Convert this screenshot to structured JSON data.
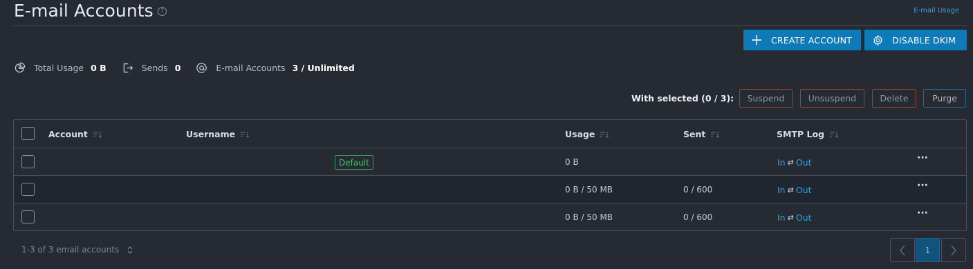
{
  "header": {
    "title": "E-mail Accounts",
    "help_icon": "question-circle-icon",
    "usage_link": "E-mail Usage"
  },
  "actions": {
    "create_label": "CREATE ACCOUNT",
    "create_icon": "plus-icon",
    "dkim_label": "DISABLE DKIM",
    "dkim_icon": "gear-icon",
    "accent_color": "#0f7ab8"
  },
  "stats": {
    "usage_label": "Total Usage",
    "usage_value": "0 B",
    "sends_label": "Sends",
    "sends_value": "0",
    "accounts_label": "E-mail Accounts",
    "accounts_value": "3 / Unlimited"
  },
  "bulk": {
    "label": "With selected (0 / 3):",
    "suspend": "Suspend",
    "unsuspend": "Unsuspend",
    "delete": "Delete",
    "purge": "Purge"
  },
  "table": {
    "columns": {
      "account": "Account",
      "username": "Username",
      "usage": "Usage",
      "sent": "Sent",
      "smtp_log": "SMTP Log"
    },
    "rows": [
      {
        "badge": "Default",
        "usage": "0 B",
        "sent": "",
        "smtp_in": "In",
        "smtp_out": "Out"
      },
      {
        "badge": "",
        "usage": "0 B / 50 MB",
        "sent": "0 / 600",
        "smtp_in": "In",
        "smtp_out": "Out"
      },
      {
        "badge": "",
        "usage": "0 B / 50 MB",
        "sent": "0 / 600",
        "smtp_in": "In",
        "smtp_out": "Out"
      }
    ],
    "swap_glyph": "⇄",
    "more_glyph": "···"
  },
  "pagination": {
    "info": "1-3 of 3 email accounts",
    "current_page": "1"
  }
}
